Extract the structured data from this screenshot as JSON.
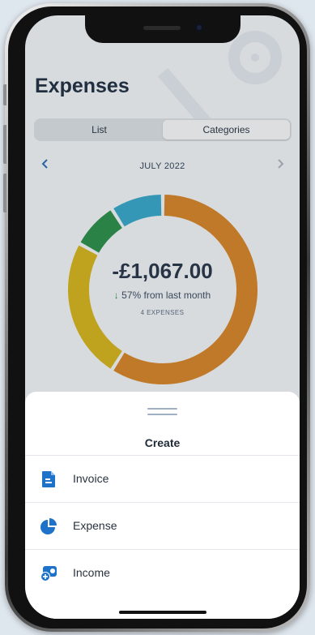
{
  "screen": {
    "title": "Expenses",
    "tabs": [
      {
        "label": "List",
        "selected": false
      },
      {
        "label": "Categories",
        "selected": true
      }
    ],
    "month_label": "JULY 2022",
    "prev_icon": "chevron-left-icon",
    "next_icon": "chevron-right-icon"
  },
  "summary": {
    "amount": "-£1,067.00",
    "change_arrow": "↓",
    "change_text": "57% from last month",
    "count": "4 EXPENSES"
  },
  "chart_data": {
    "type": "pie",
    "segments": [
      {
        "color": "#d4862d",
        "fraction": 0.59
      },
      {
        "color": "#d2b320",
        "fraction": 0.24
      },
      {
        "color": "#2f8f4e",
        "fraction": 0.08
      },
      {
        "color": "#3aa7c9",
        "fraction": 0.09
      }
    ]
  },
  "sheet": {
    "title": "Create",
    "items": [
      {
        "label": "Invoice",
        "icon": "invoice-icon"
      },
      {
        "label": "Expense",
        "icon": "pie-chart-icon"
      },
      {
        "label": "Income",
        "icon": "income-icon"
      }
    ]
  },
  "colors": {
    "accent": "#1f72c9",
    "title": "#243447"
  }
}
